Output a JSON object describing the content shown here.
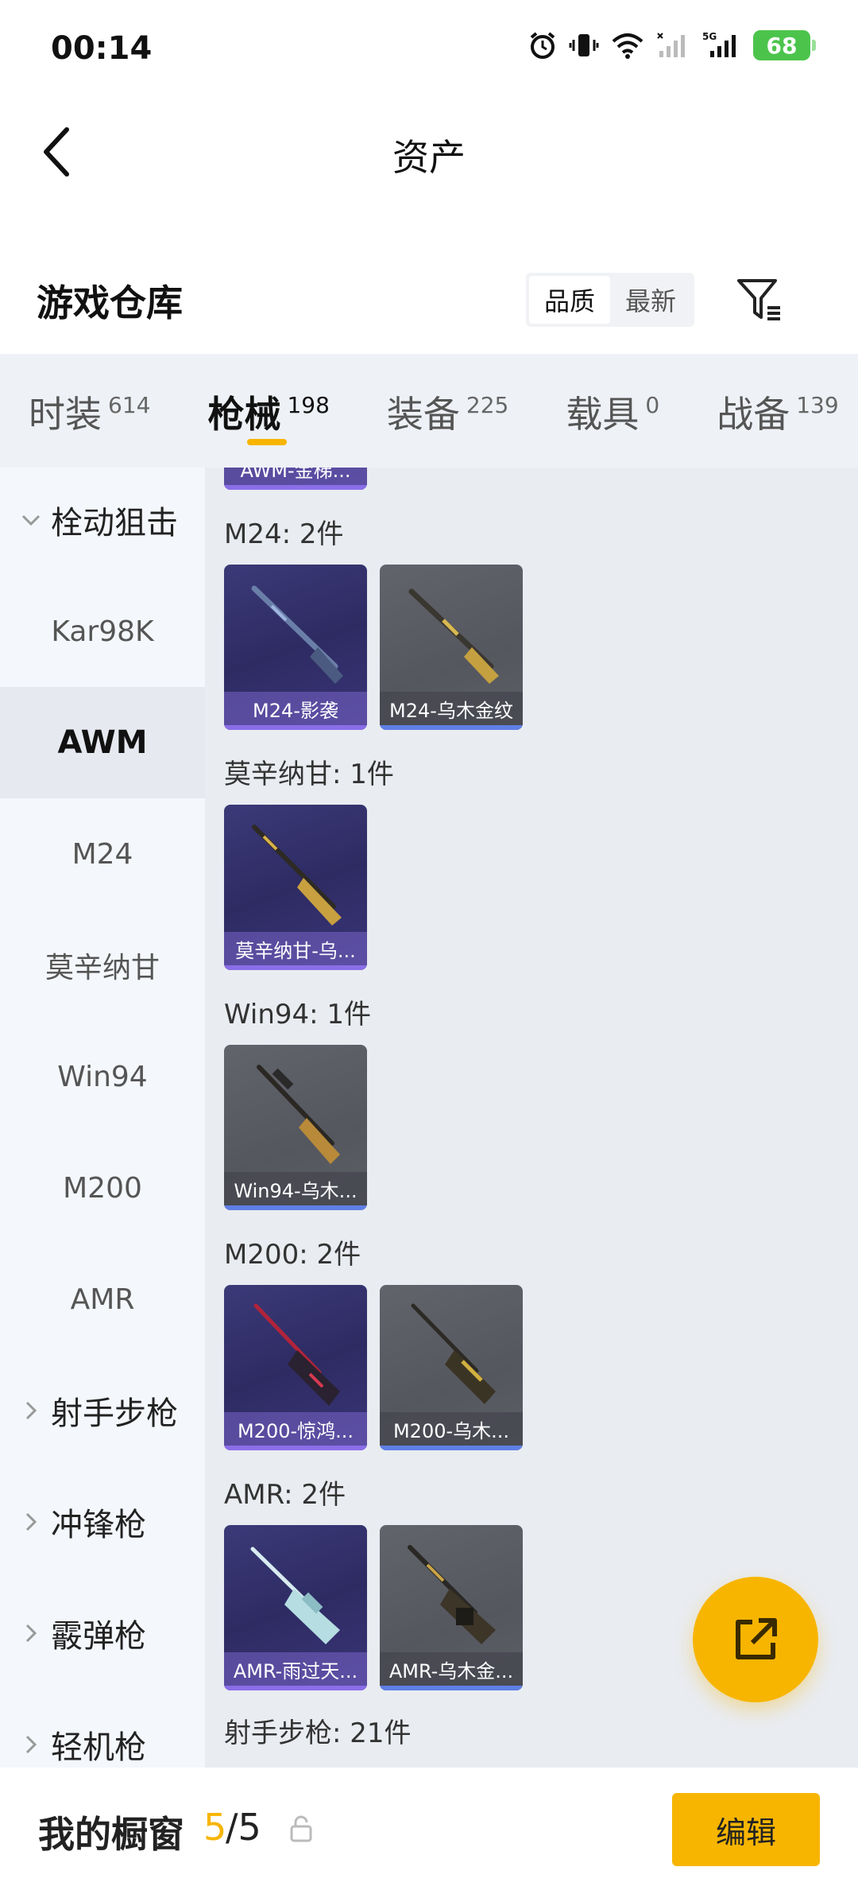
{
  "status_bar": {
    "time": "00:14",
    "battery": "68"
  },
  "header": {
    "title": "资产"
  },
  "section": {
    "title": "游戏仓库",
    "sort_options": [
      "品质",
      "最新"
    ],
    "active_sort": "品质"
  },
  "tabs": [
    {
      "label": "时装",
      "count": "614"
    },
    {
      "label": "枪械",
      "count": "198",
      "active": true
    },
    {
      "label": "装备",
      "count": "225"
    },
    {
      "label": "载具",
      "count": "0"
    },
    {
      "label": "战备",
      "count": "139"
    }
  ],
  "sidebar": {
    "group_sniper": "栓动狙击",
    "items": [
      "Kar98K",
      "AWM",
      "M24",
      "莫辛纳甘",
      "Win94",
      "M200",
      "AMR"
    ],
    "active_item": "AWM",
    "groups": [
      "射手步枪",
      "冲锋枪",
      "霰弹枪",
      "轻机枪"
    ]
  },
  "content": {
    "partial_card_label": "AWM-金梯...",
    "groups": [
      {
        "label": "M24: 2件",
        "cards": [
          {
            "name": "M24-影袭",
            "style": "purple"
          },
          {
            "name": "M24-乌木金纹",
            "style": "gray"
          }
        ]
      },
      {
        "label": "莫辛纳甘: 1件",
        "cards": [
          {
            "name": "莫辛纳甘-乌...",
            "style": "purple"
          }
        ]
      },
      {
        "label": "Win94: 1件",
        "cards": [
          {
            "name": "Win94-乌木...",
            "style": "gray"
          }
        ]
      },
      {
        "label": "M200: 2件",
        "cards": [
          {
            "name": "M200-惊鸿...",
            "style": "purple"
          },
          {
            "name": "M200-乌木...",
            "style": "gray"
          }
        ]
      },
      {
        "label": "AMR: 2件",
        "cards": [
          {
            "name": "AMR-雨过天...",
            "style": "purple"
          },
          {
            "name": "AMR-乌木金...",
            "style": "gray"
          }
        ]
      }
    ],
    "trailing_label": "射手步枪: 21件"
  },
  "bottom_bar": {
    "title": "我的橱窗",
    "current": "5",
    "total": "/5",
    "edit_label": "编辑"
  },
  "colors": {
    "accent": "#f7b500",
    "card_purple": "#35326e",
    "card_gray": "#5a5c64"
  }
}
